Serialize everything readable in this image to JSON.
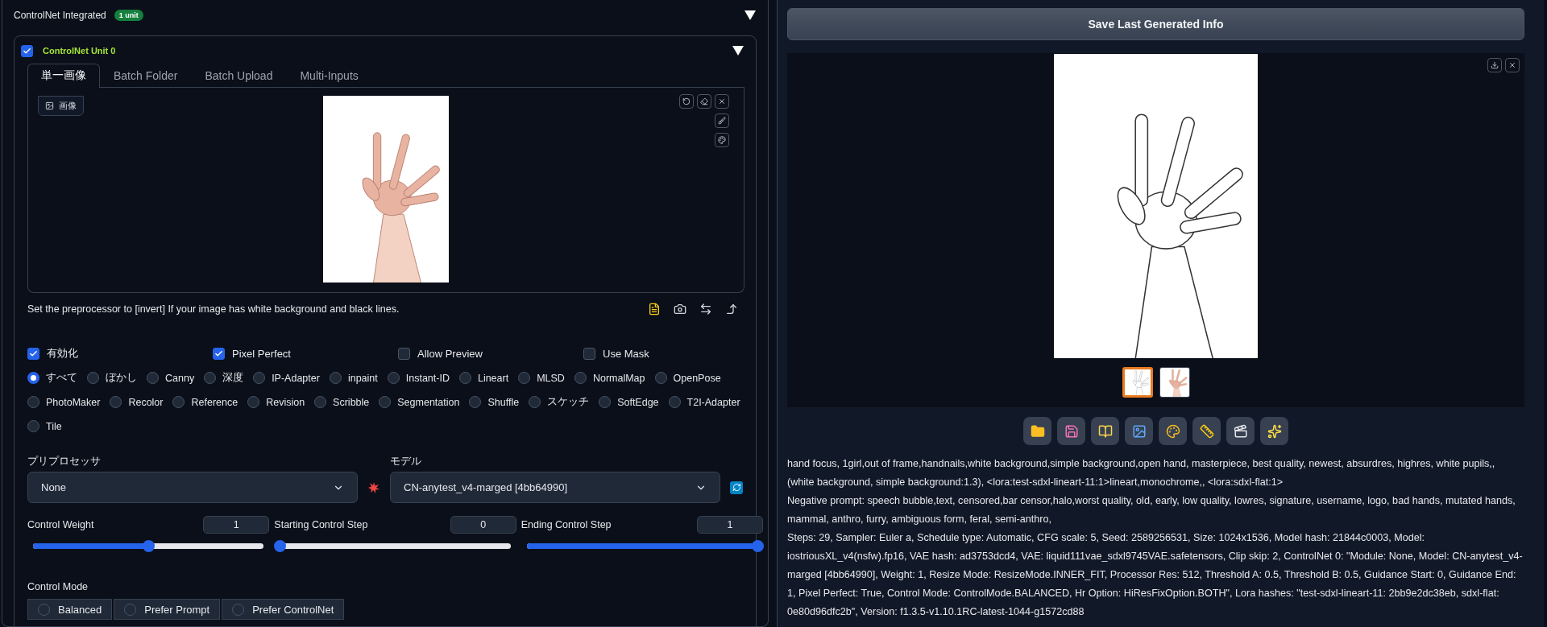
{
  "controlnet": {
    "title": "ControlNet Integrated",
    "badge": "1 unit",
    "expanded": true,
    "unit": {
      "title": "ControlNet Unit 0",
      "enabled": true,
      "expanded": true,
      "tabs": [
        {
          "label": "単一画像",
          "selected": true
        },
        {
          "label": "Batch Folder",
          "selected": false
        },
        {
          "label": "Batch Upload",
          "selected": false
        },
        {
          "label": "Multi-Inputs",
          "selected": false
        }
      ],
      "image_label": "画像",
      "image": {
        "kind": "picture"
      },
      "hint": "Set the preprocessor to [invert] If your image has white background and black lines.",
      "options": [
        {
          "label": "有効化",
          "checked": true
        },
        {
          "label": "Pixel Perfect",
          "checked": true
        },
        {
          "label": "Allow Preview",
          "checked": false
        },
        {
          "label": "Use Mask",
          "checked": false
        }
      ],
      "control_types": [
        {
          "label": "すべて",
          "selected": true
        },
        {
          "label": "ぼかし",
          "selected": false
        },
        {
          "label": "Canny",
          "selected": false
        },
        {
          "label": "深度",
          "selected": false
        },
        {
          "label": "IP-Adapter",
          "selected": false
        },
        {
          "label": "inpaint",
          "selected": false
        },
        {
          "label": "Instant-ID",
          "selected": false
        },
        {
          "label": "Lineart",
          "selected": false
        },
        {
          "label": "MLSD",
          "selected": false
        },
        {
          "label": "NormalMap",
          "selected": false
        },
        {
          "label": "OpenPose",
          "selected": false
        },
        {
          "label": "PhotoMaker",
          "selected": false
        },
        {
          "label": "Recolor",
          "selected": false
        },
        {
          "label": "Reference",
          "selected": false
        },
        {
          "label": "Revision",
          "selected": false
        },
        {
          "label": "Scribble",
          "selected": false
        },
        {
          "label": "Segmentation",
          "selected": false
        },
        {
          "label": "Shuffle",
          "selected": false
        },
        {
          "label": "スケッチ",
          "selected": false
        },
        {
          "label": "SoftEdge",
          "selected": false
        },
        {
          "label": "T2I-Adapter",
          "selected": false
        },
        {
          "label": "Tile",
          "selected": false
        }
      ],
      "preprocessor": {
        "label": "プリプロセッサ",
        "value": "None"
      },
      "model": {
        "label": "モデル",
        "value": "CN-anytest_v4-marged [4bb64990]"
      },
      "sliders": [
        {
          "label": "Control Weight",
          "value": "1",
          "level": 0.5
        },
        {
          "label": "Starting Control Step",
          "value": "0",
          "level": 0
        },
        {
          "label": "Ending Control Step",
          "value": "1",
          "level": 1
        }
      ],
      "control_mode": {
        "label": "Control Mode",
        "options": [
          {
            "label": "Balanced",
            "selected": false
          },
          {
            "label": "Prefer Prompt",
            "selected": false
          },
          {
            "label": "Prefer ControlNet",
            "selected": false
          }
        ]
      }
    }
  },
  "output": {
    "save_button": "Save Last Generated Info",
    "image": {
      "kind": "picture"
    },
    "thumbnails": [
      {
        "selected": true
      },
      {
        "selected": false
      }
    ],
    "info": [
      "hand focus, 1girl,out of frame,handnails,white background,simple background,open hand, masterpiece, best quality, newest, absurdres, highres, white pupils,, (white background, simple background:1.3), <lora:test-sdxl-lineart-11:1>lineart,monochrome,, <lora:sdxl-flat:1>",
      "Negative prompt: speech bubble,text, censored,bar censor,halo,worst quality, old, early, low quality, lowres, signature, username, logo, bad hands, mutated hands, mammal, anthro, furry, ambiguous form, feral, semi-anthro,",
      "Steps: 29, Sampler: Euler a, Schedule type: Automatic, CFG scale: 5, Seed: 2589256531, Size: 1024x1536, Model hash: 21844c0003, Model: iostriousXL_v4(nsfw).fp16, VAE hash: ad3753dcd4, VAE: liquid111vae_sdxl9745VAE.safetensors, Clip skip: 2, ControlNet 0: \"Module: None, Model: CN-anytest_v4-marged [4bb64990], Weight: 1, Resize Mode: ResizeMode.INNER_FIT, Processor Res: 512, Threshold A: 0.5, Threshold B: 0.5, Guidance Start: 0, Guidance End: 1, Pixel Perfect: True, Control Mode: ControlMode.BALANCED, Hr Option: HiResFixOption.BOTH\", Lora hashes: \"test-sdxl-lineart-11: 2bb9e2dc38eb, sdxl-flat: 0e80d96dfc2b\", Version: f1.3.5-v1.10.1RC-latest-1044-g1572cd88"
    ]
  }
}
